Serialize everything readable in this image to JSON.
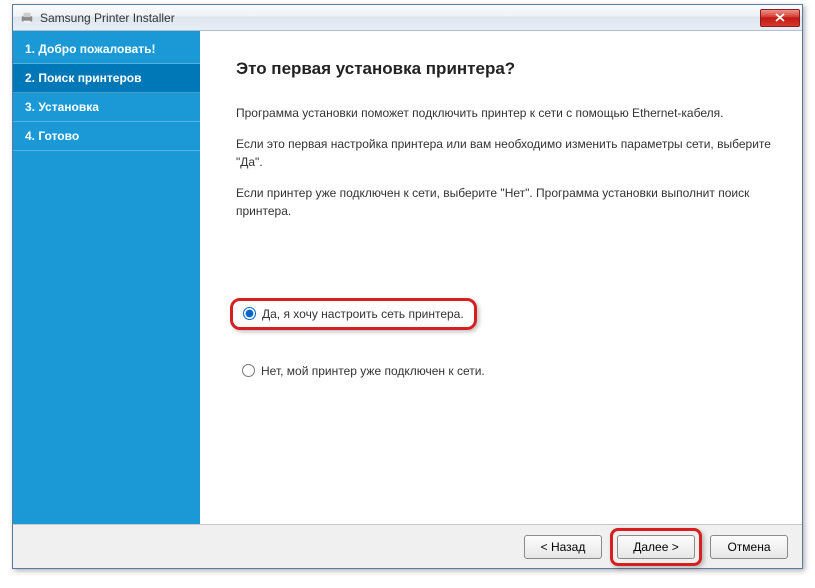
{
  "window": {
    "title": "Samsung Printer Installer"
  },
  "sidebar": {
    "steps": [
      {
        "label": "1. Добро пожаловать!"
      },
      {
        "label": "2. Поиск принтеров"
      },
      {
        "label": "3. Установка"
      },
      {
        "label": "4. Готово"
      }
    ],
    "activeIndex": 1
  },
  "main": {
    "heading": "Это первая установка принтера?",
    "para1": "Программа установки поможет подключить принтер к сети с помощью Ethernet-кабеля.",
    "para2": "Если это первая настройка принтера или вам необходимо изменить параметры сети, выберите \"Да\".",
    "para3": "Если принтер уже подключен к сети, выберите \"Нет\". Программа установки выполнит поиск принтера.",
    "optionYes": "Да, я хочу настроить сеть принтера.",
    "optionNo": "Нет, мой принтер уже подключен к сети."
  },
  "footer": {
    "back": "< Назад",
    "next": "Далее >",
    "cancel": "Отмена"
  }
}
